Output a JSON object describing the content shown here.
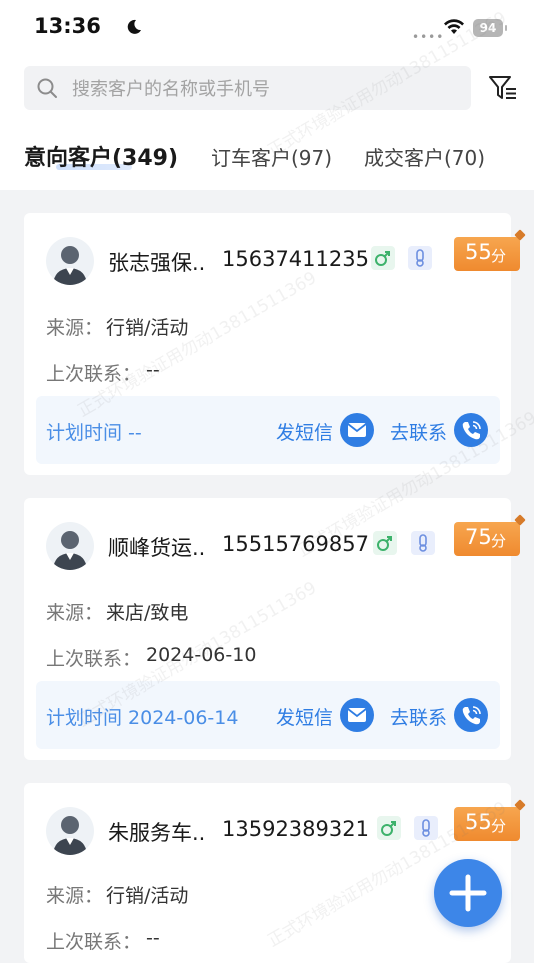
{
  "status_bar": {
    "time": "13:36",
    "battery": "94"
  },
  "search": {
    "placeholder": "搜索客户的名称或手机号"
  },
  "tabs": [
    {
      "label": "意向客户(349)"
    },
    {
      "label": "订车客户(97)"
    },
    {
      "label": "成交客户(70)"
    }
  ],
  "cards": [
    {
      "name": "张志强保..",
      "phone": "15637411235",
      "score": "55",
      "score_unit": "分",
      "source_label": "来源：",
      "source_value": "行销/活动",
      "last_contact_label": "上次联系：",
      "last_contact_value": "--",
      "plan_label": "计划时间 --",
      "sms_label": "发短信",
      "contact_label": "去联系"
    },
    {
      "name": "顺峰货运..",
      "phone": "15515769857",
      "score": "75",
      "score_unit": "分",
      "source_label": "来源：",
      "source_value": "来店/致电",
      "last_contact_label": "上次联系：",
      "last_contact_value": "2024-06-10",
      "plan_label": "计划时间 2024-06-14",
      "sms_label": "发短信",
      "contact_label": "去联系"
    },
    {
      "name": "朱服务车..",
      "phone": "13592389321",
      "score": "55",
      "score_unit": "分",
      "source_label": "来源：",
      "source_value": "行销/活动",
      "last_contact_label": "上次联系：",
      "last_contact_value": "--"
    }
  ],
  "watermark": "正式环境验证用勿动13811511369",
  "colors": {
    "accent": "#2f7de3",
    "score": "#f39a3e",
    "gender": "#3db26b"
  }
}
